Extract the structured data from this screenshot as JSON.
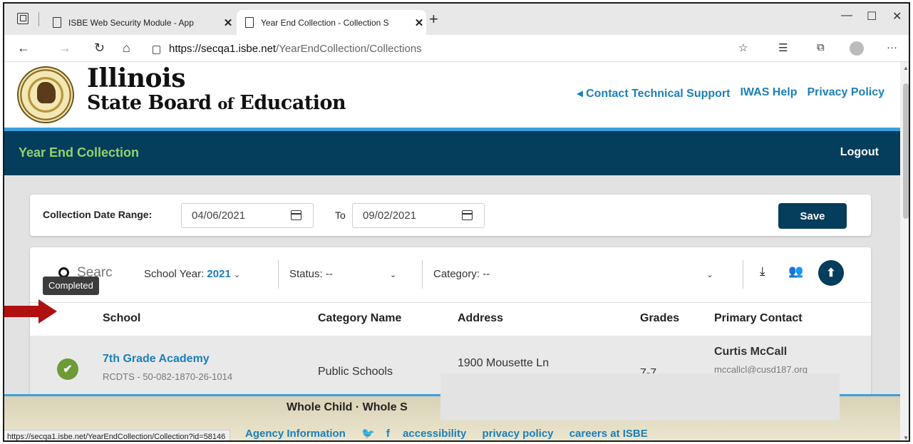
{
  "browser": {
    "tabs": [
      {
        "title": "ISBE Web Security Module - App",
        "active": false
      },
      {
        "title": "Year End Collection - Collection S",
        "active": true
      }
    ],
    "url_host": "https://secqa1.isbe.net",
    "url_path": "/YearEndCollection/Collections",
    "status_url": "https://secqa1.isbe.net/YearEndCollection/Collection?id=58146"
  },
  "header": {
    "brand_line1": "Illinois",
    "brand_line2_a": "State Board ",
    "brand_line2_b": "of",
    "brand_line2_c": " Education",
    "links": [
      "◂ Contact Technical Support",
      "IWAS Help",
      "Privacy Policy"
    ]
  },
  "app": {
    "title": "Year End Collection",
    "logout": "Logout"
  },
  "date_range": {
    "label": "Collection Date Range:",
    "from": "04/06/2021",
    "to_label": "To",
    "to": "09/02/2021",
    "save": "Save"
  },
  "filters": {
    "search_placeholder": "Searc",
    "school_year_label": "School Year:",
    "school_year_value": "2021",
    "status_label": "Status: --",
    "category_label": "Category: --"
  },
  "table": {
    "columns": [
      "School",
      "Category Name",
      "Address",
      "Grades",
      "Primary Contact"
    ],
    "rows": [
      {
        "school": "7th Grade Academy",
        "code": "RCDTS - 50-082-1870-26-1014",
        "category": "Public Schools",
        "address": "1900 Mousette Ln",
        "grades": "7-7",
        "contact_name": "Curtis McCall",
        "contact_email": "mccallcl@cusd187.org",
        "status": "Completed"
      }
    ]
  },
  "footer": {
    "tagline": "Whole Child · Whole S",
    "links": [
      "Agency Information",
      "accessibility",
      "privacy policy",
      "careers at ISBE"
    ]
  },
  "colors": {
    "navy": "#053d5c",
    "accent_blue": "#1b7fb9",
    "green_title": "#8fd36b",
    "status_green": "#6e9a38",
    "arrow_red": "#b01010"
  }
}
